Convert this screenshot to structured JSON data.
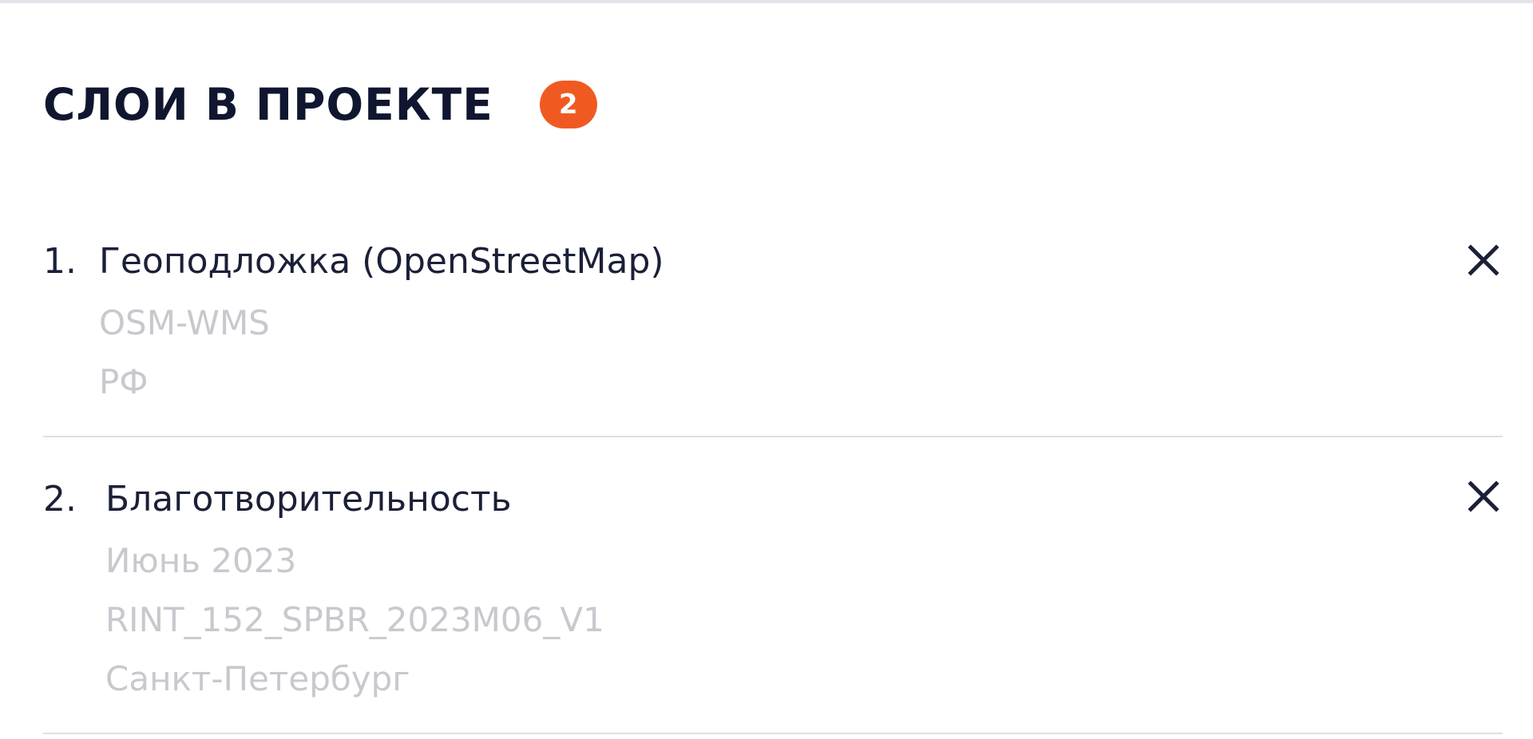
{
  "panel": {
    "title": "СЛОИ В ПРОЕКТЕ",
    "layer_count": "2"
  },
  "layers": [
    {
      "number": "1.",
      "name": "Геоподложка (OpenStreetMap)",
      "details": [
        "OSM-WMS",
        "РФ"
      ]
    },
    {
      "number": "2.",
      "name": "Благотворительность",
      "details": [
        "Июнь 2023",
        "RINT_152_SPBR_2023M06_V1",
        "Санкт-Петербург"
      ]
    }
  ],
  "colors": {
    "badge": "#f05a22",
    "title": "#10162f",
    "meta": "#c8c8ce",
    "divider": "#dfdfe4"
  },
  "icons": {
    "remove": "close-icon"
  }
}
